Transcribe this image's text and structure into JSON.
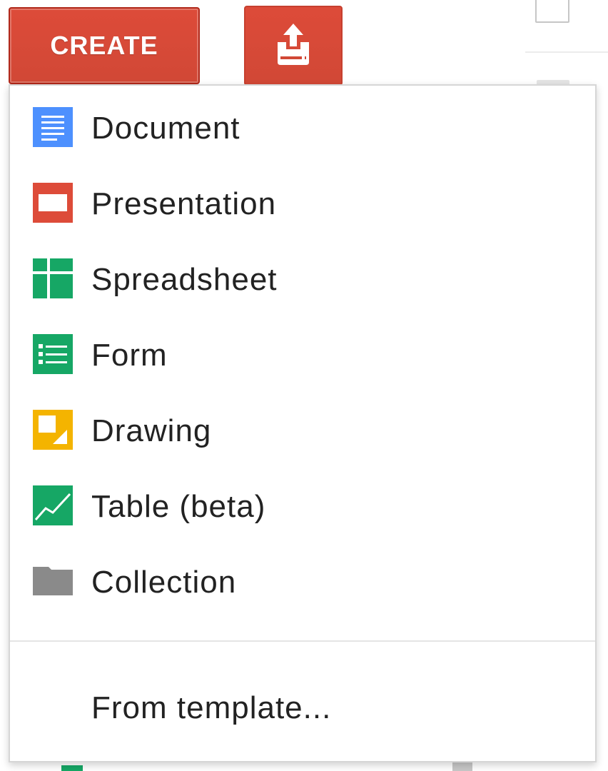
{
  "toolbar": {
    "create_label": "CREATE",
    "upload_icon": "upload-icon",
    "accent_color": "#dd4b39"
  },
  "create_menu": {
    "items": [
      {
        "label": "Document",
        "icon": "document-icon",
        "color": "#4d90fe"
      },
      {
        "label": "Presentation",
        "icon": "presentation-icon",
        "color": "#dd4b39"
      },
      {
        "label": "Spreadsheet",
        "icon": "spreadsheet-icon",
        "color": "#16a765"
      },
      {
        "label": "Form",
        "icon": "form-icon",
        "color": "#16a765"
      },
      {
        "label": "Drawing",
        "icon": "drawing-icon",
        "color": "#f4b400"
      },
      {
        "label": "Table (beta)",
        "icon": "table-icon",
        "color": "#16a765"
      },
      {
        "label": "Collection",
        "icon": "folder-icon",
        "color": "#8a8a8a"
      }
    ],
    "template_label": "From template..."
  }
}
